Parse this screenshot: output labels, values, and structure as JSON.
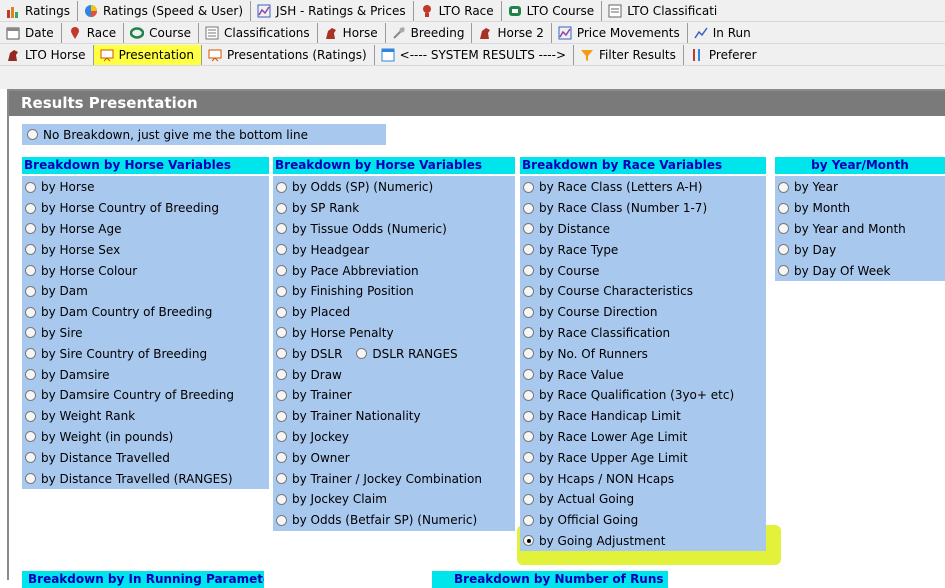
{
  "tabs": {
    "row1": [
      {
        "label": "Ratings",
        "icon": "bar-chart-icon"
      },
      {
        "label": "Ratings (Speed & User)",
        "icon": "pie-chart-icon"
      },
      {
        "label": "JSH - Ratings & Prices",
        "icon": "price-chart-icon"
      },
      {
        "label": "LTO Race",
        "icon": "lto-race-icon"
      },
      {
        "label": "LTO Course",
        "icon": "lto-course-icon"
      },
      {
        "label": "LTO Classificati",
        "icon": "lto-classification-icon"
      }
    ],
    "row2": [
      {
        "label": "Date",
        "icon": "calendar-icon"
      },
      {
        "label": "Race",
        "icon": "pin-icon"
      },
      {
        "label": "Course",
        "icon": "course-icon"
      },
      {
        "label": "Classifications",
        "icon": "list-icon"
      },
      {
        "label": "Horse",
        "icon": "horse-icon"
      },
      {
        "label": "Breeding",
        "icon": "breeding-icon"
      },
      {
        "label": "Horse 2",
        "icon": "horse-icon"
      },
      {
        "label": "Price Movements",
        "icon": "price-chart-icon"
      },
      {
        "label": "In Run",
        "icon": "line-chart-icon"
      }
    ],
    "row3": [
      {
        "label": "LTO Horse",
        "icon": "lto-horse-icon"
      },
      {
        "label": "Presentation",
        "icon": "presentation-icon",
        "active": true
      },
      {
        "label": "Presentations (Ratings)",
        "icon": "presentation-icon"
      },
      {
        "label": "<---- SYSTEM RESULTS ---->",
        "icon": "window-icon"
      },
      {
        "label": "Filter Results",
        "icon": "filter-icon"
      },
      {
        "label": "Preferer",
        "icon": "preferences-icon"
      }
    ]
  },
  "panel": {
    "title": "Results Presentation",
    "no_breakdown": "No Breakdown, just give me the bottom line"
  },
  "groups": [
    {
      "header": "Breakdown by Horse Variables",
      "options": [
        "by Horse",
        "by Horse Country of Breeding",
        "by Horse Age",
        "by Horse Sex",
        "by Horse Colour",
        "by Dam",
        "by Dam Country of Breeding",
        "by Sire",
        "by Sire Country of Breeding",
        "by Damsire",
        "by Damsire Country of Breeding",
        "by Weight Rank",
        "by Weight (in pounds)",
        "by Distance Travelled",
        "by Distance Travelled (RANGES)"
      ]
    },
    {
      "header": "Breakdown by Horse Variables",
      "options": [
        "by Odds (SP) (Numeric)",
        "by SP Rank",
        "by Tissue Odds (Numeric)",
        "by Headgear",
        "by Pace Abbreviation",
        "by Finishing Position",
        "by Placed",
        "by Horse Penalty",
        "by DSLR",
        "by Draw",
        "by Trainer",
        "by Trainer Nationality",
        "by Jockey",
        "by Owner",
        "by Trainer / Jockey Combination",
        "by Jockey Claim",
        "by Odds (Betfair SP) (Numeric)"
      ],
      "dslr_ranges": "DSLR RANGES"
    },
    {
      "header": "Breakdown by Race Variables",
      "options": [
        "by Race Class (Letters A-H)",
        "by Race Class (Number 1-7)",
        "by Distance",
        "by Race Type",
        "by Course",
        "by Course Characteristics",
        "by Course Direction",
        "by Race Classification",
        "by No. Of Runners",
        "by Race Value",
        "by Race Qualification (3yo+ etc)",
        "by Race Handicap Limit",
        "by Race Lower Age Limit",
        "by Race Upper Age Limit",
        "by Hcaps / NON Hcaps",
        "by Actual Going",
        "by Official Going",
        "by Going Adjustment"
      ],
      "selected": "by Going Adjustment"
    },
    {
      "header": "by Year/Month",
      "options": [
        "by Year",
        "by Month",
        "by Year and Month",
        "by Day",
        "by Day Of Week"
      ]
    }
  ],
  "bottom_headers": [
    "Breakdown by In Running Parameters",
    "Breakdown by Number of Runs"
  ],
  "colors": {
    "group_header_bg": "#00e4ec",
    "group_header_text": "#0000b8",
    "list_bg": "#a9c8ee",
    "active_tab": "#ffff44",
    "highlight": "#e2f13a",
    "title_bar": "#7a7a7a"
  }
}
